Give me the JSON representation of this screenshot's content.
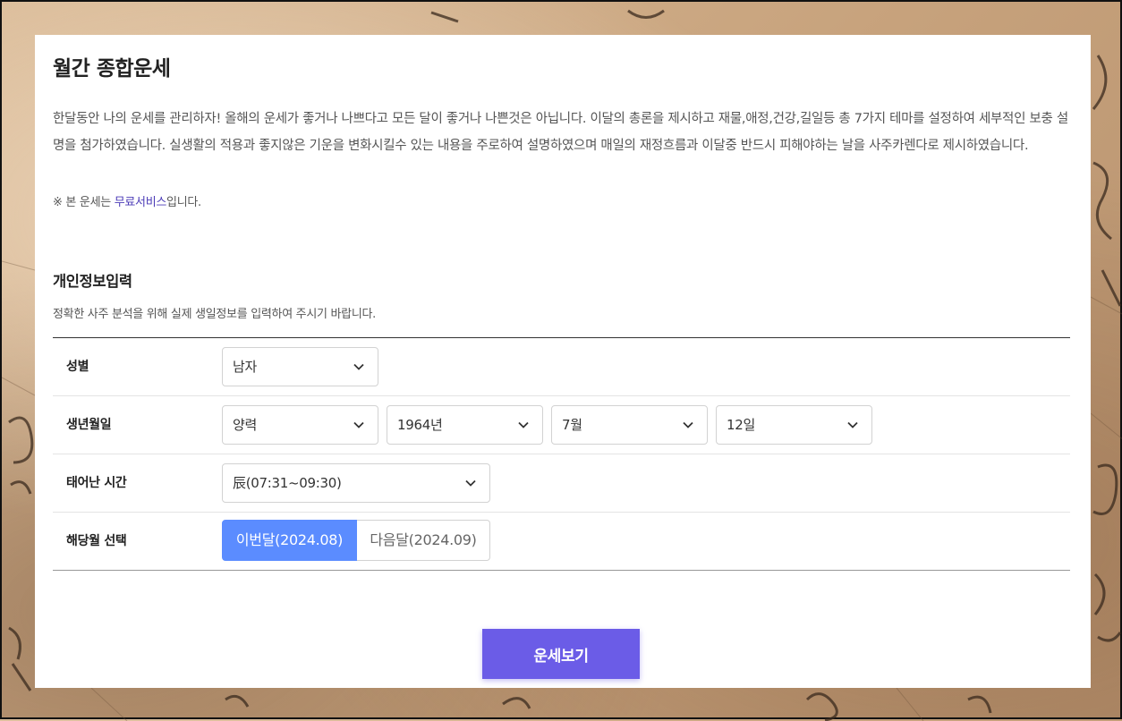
{
  "header": {
    "title": "월간 종합운세"
  },
  "intro": {
    "description": "한달동안 나의 운세를 관리하자! 올해의 운세가 좋거나 나쁘다고 모든 달이 좋거나 나쁜것은 아닙니다. 이달의 총론을 제시하고 재물,애정,건강,길일등 총 7가지 테마를 설정하여 세부적인 보충 설명을 첨가하였습니다. 실생활의 적용과 좋지않은 기운을 변화시킬수 있는 내용을 주로하여 설명하였으며 매일의 재정흐름과 이달중 반드시 피해야하는 날을 사주카렌다로 제시하였습니다.",
    "notice_prefix": "※ 본 운세는 ",
    "notice_highlight": "무료서비스",
    "notice_suffix": "입니다."
  },
  "personal_info": {
    "title": "개인정보입력",
    "subtitle": "정확한 사주 분석을 위해 실제 생일정보를 입력하여 주시기 바랍니다."
  },
  "form": {
    "gender": {
      "label": "성별",
      "value": "남자"
    },
    "birthdate": {
      "label": "생년월일",
      "calendar": "양력",
      "year": "1964년",
      "month": "7월",
      "day": "12일"
    },
    "birth_time": {
      "label": "태어난 시간",
      "value": "辰(07:31~09:30)"
    },
    "month_select": {
      "label": "해당월 선택",
      "current": "이번달(2024.08)",
      "next": "다음달(2024.09)",
      "selected": "current"
    }
  },
  "actions": {
    "submit_label": "운세보기"
  },
  "colors": {
    "accent_blue": "#5b8cff",
    "submit_purple": "#6b5ce7",
    "link_purple": "#4b3bb7"
  }
}
